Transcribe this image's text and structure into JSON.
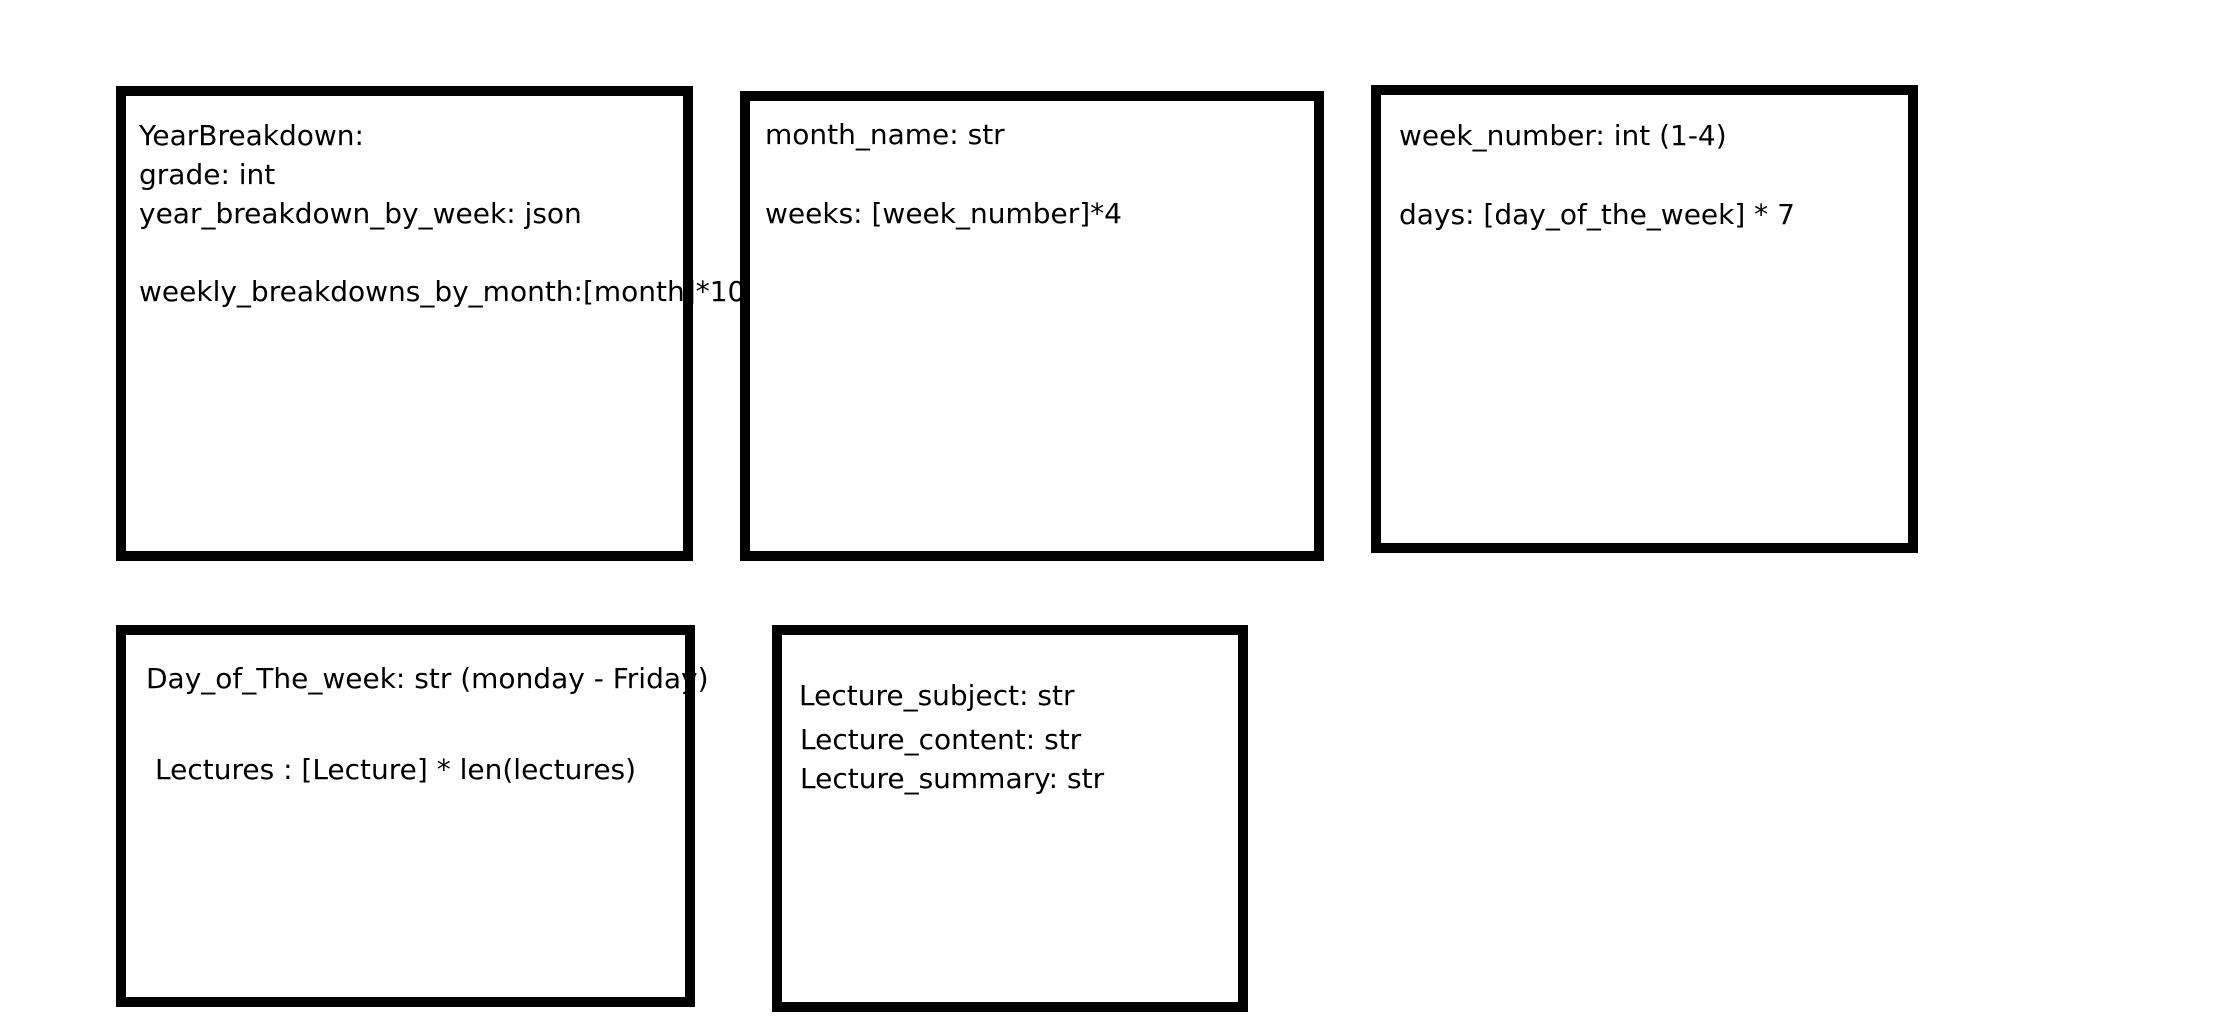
{
  "diagram": {
    "boxes": [
      {
        "id": "year_breakdown",
        "lines": [
          "YearBreakdown:",
          "grade: int",
          "year_breakdown_by_week: json",
          "weekly_breakdowns_by_month:[month]*10"
        ]
      },
      {
        "id": "month",
        "lines": [
          "month_name: str",
          "weeks: [week_number]*4"
        ]
      },
      {
        "id": "week",
        "lines": [
          "week_number: int (1-4)",
          "days: [day_of_the_week] * 7"
        ]
      },
      {
        "id": "day_of_the_week",
        "lines": [
          "Day_of_The_week: str (monday - Friday)",
          "Lectures : [Lecture] * len(lectures)"
        ]
      },
      {
        "id": "lecture",
        "lines": [
          "Lecture_subject: str",
          "Lecture_content: str",
          "Lecture_summary: str"
        ]
      }
    ],
    "colors": {
      "border": "#000000",
      "background": "#ffffff",
      "text": "#000000"
    }
  }
}
